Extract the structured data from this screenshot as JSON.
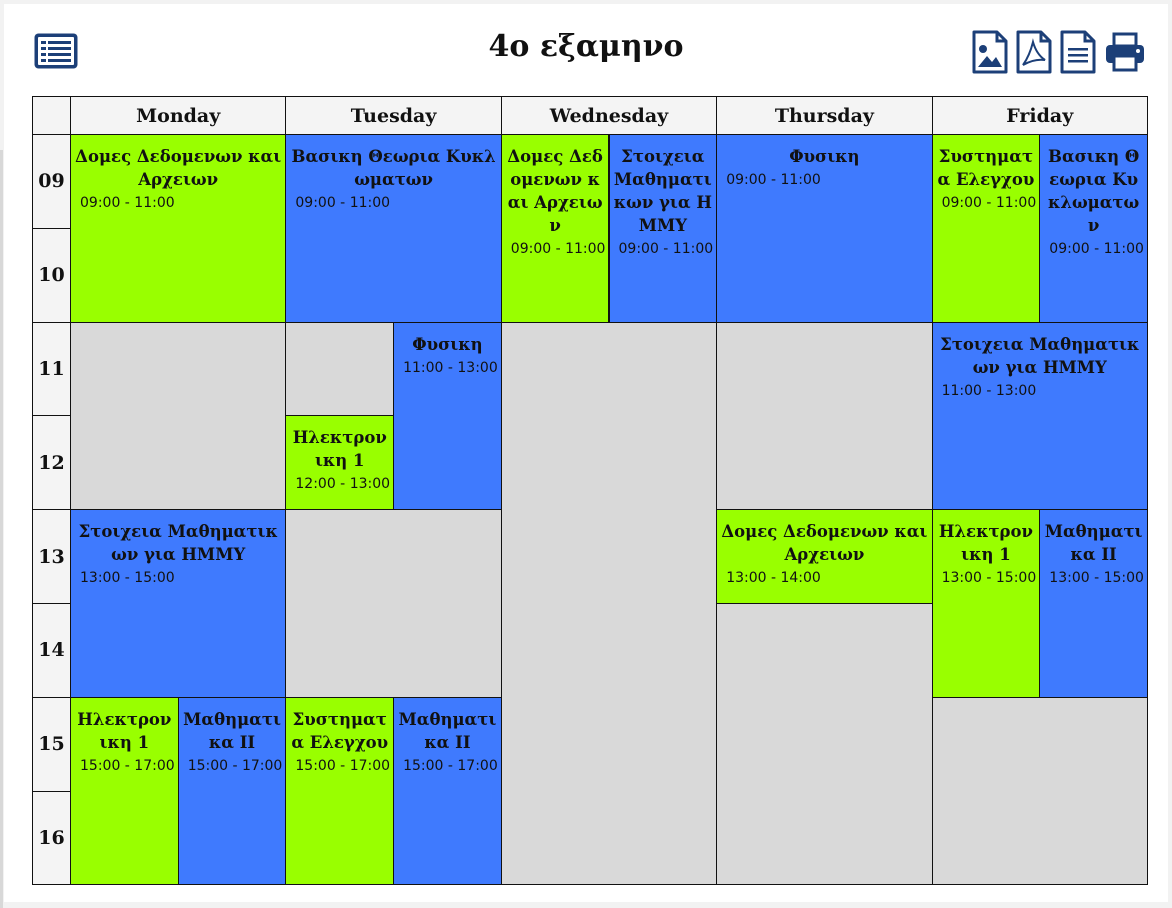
{
  "title": "4ο εξαμηνο",
  "toolbar": {
    "menu_icon": "list-icon",
    "icons": [
      "image-export-icon",
      "pdf-export-icon",
      "document-export-icon",
      "print-icon"
    ],
    "color": "#1c3f78"
  },
  "days": [
    "Monday",
    "Tuesday",
    "Wednesday",
    "Thursday",
    "Friday"
  ],
  "hours": [
    "09",
    "10",
    "11",
    "12",
    "13",
    "14",
    "15",
    "16"
  ],
  "colors": {
    "green": "#99ff00",
    "blue": "#3f7afe",
    "empty": "#d9d9d9"
  },
  "events": [
    {
      "day": 0,
      "start": 0,
      "span": 2,
      "col": 0,
      "cols": 1,
      "color": "green",
      "title": "Δομες Δεδομενων και Αρχειων",
      "time": "09:00 - 11:00"
    },
    {
      "day": 0,
      "start": 4,
      "span": 2,
      "col": 0,
      "cols": 1,
      "color": "blue",
      "title": "Στοιχεια Μαθηματικων για ΗΜΜΥ",
      "time": "13:00 - 15:00"
    },
    {
      "day": 0,
      "start": 6,
      "span": 2,
      "col": 0,
      "cols": 2,
      "color": "green",
      "title": "Ηλεκτρονικη 1",
      "time": "15:00 - 17:00"
    },
    {
      "day": 0,
      "start": 6,
      "span": 2,
      "col": 1,
      "cols": 2,
      "color": "blue",
      "title": "Μαθηματικα ΙΙ",
      "time": "15:00 - 17:00"
    },
    {
      "day": 1,
      "start": 0,
      "span": 2,
      "col": 0,
      "cols": 1,
      "color": "blue",
      "title": "Βασικη Θεωρια Κυκλωματων",
      "time": "09:00 - 11:00"
    },
    {
      "day": 1,
      "start": 2,
      "span": 2,
      "col": 1,
      "cols": 2,
      "color": "blue",
      "title": "Φυσικη",
      "time": "11:00 - 13:00"
    },
    {
      "day": 1,
      "start": 3,
      "span": 1,
      "col": 0,
      "cols": 2,
      "color": "green",
      "title": "Ηλεκτρονικη 1",
      "time": "12:00 - 13:00"
    },
    {
      "day": 1,
      "start": 6,
      "span": 2,
      "col": 0,
      "cols": 2,
      "color": "green",
      "title": "Συστηματα Ελεγχου",
      "time": "15:00 - 17:00"
    },
    {
      "day": 1,
      "start": 6,
      "span": 2,
      "col": 1,
      "cols": 2,
      "color": "blue",
      "title": "Μαθηματικα ΙΙ",
      "time": "15:00 - 17:00"
    },
    {
      "day": 2,
      "start": 0,
      "span": 2,
      "col": 0,
      "cols": 2,
      "color": "green",
      "title": "Δομες Δεδομενων και Αρχειων",
      "time": "09:00 - 11:00"
    },
    {
      "day": 2,
      "start": 0,
      "span": 2,
      "col": 1,
      "cols": 2,
      "color": "blue",
      "title": "Στοιχεια Μαθηματικων για ΗΜΜΥ",
      "time": "09:00 - 11:00"
    },
    {
      "day": 3,
      "start": 0,
      "span": 2,
      "col": 0,
      "cols": 1,
      "color": "blue",
      "title": "Φυσικη",
      "time": "09:00 - 11:00"
    },
    {
      "day": 3,
      "start": 4,
      "span": 1,
      "col": 0,
      "cols": 1,
      "color": "green",
      "title": "Δομες Δεδομενων και Αρχειων",
      "time": "13:00 - 14:00"
    },
    {
      "day": 4,
      "start": 0,
      "span": 2,
      "col": 0,
      "cols": 2,
      "color": "green",
      "title": "Συστηματα Ελεγχου",
      "time": "09:00 - 11:00"
    },
    {
      "day": 4,
      "start": 0,
      "span": 2,
      "col": 1,
      "cols": 2,
      "color": "blue",
      "title": "Βασικη Θεωρια Κυκλωματων",
      "time": "09:00 - 11:00"
    },
    {
      "day": 4,
      "start": 2,
      "span": 2,
      "col": 0,
      "cols": 1,
      "color": "blue",
      "title": "Στοιχεια Μαθηματικων για ΗΜΜΥ",
      "time": "11:00 - 13:00"
    },
    {
      "day": 4,
      "start": 4,
      "span": 2,
      "col": 0,
      "cols": 2,
      "color": "green",
      "title": "Ηλεκτρονικη 1",
      "time": "13:00 - 15:00"
    },
    {
      "day": 4,
      "start": 4,
      "span": 2,
      "col": 1,
      "cols": 2,
      "color": "blue",
      "title": "Μαθηματικα ΙΙ",
      "time": "13:00 - 15:00"
    }
  ],
  "empties": [
    {
      "day": 0,
      "start": 2,
      "span": 2,
      "col": 0,
      "cols": 1
    },
    {
      "day": 1,
      "start": 2,
      "span": 1,
      "col": 0,
      "cols": 2
    },
    {
      "day": 1,
      "start": 4,
      "span": 2,
      "col": 0,
      "cols": 1
    },
    {
      "day": 2,
      "start": 2,
      "span": 6,
      "col": 0,
      "cols": 1
    },
    {
      "day": 3,
      "start": 2,
      "span": 2,
      "col": 0,
      "cols": 1
    },
    {
      "day": 3,
      "start": 5,
      "span": 3,
      "col": 0,
      "cols": 1
    },
    {
      "day": 4,
      "start": 6,
      "span": 2,
      "col": 0,
      "cols": 1
    }
  ]
}
